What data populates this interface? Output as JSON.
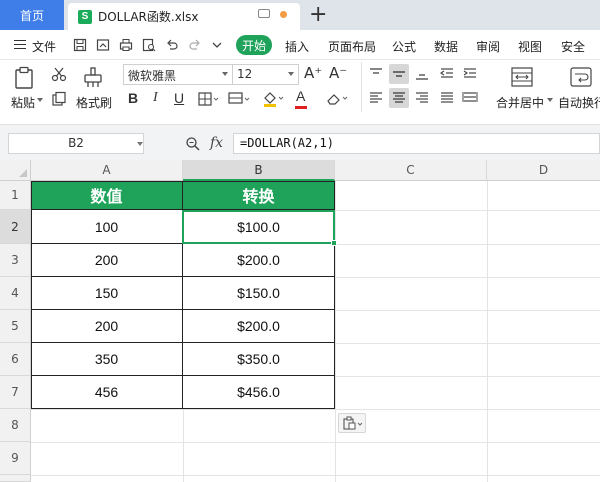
{
  "tabs": {
    "home_label": "首页",
    "file_name": "DOLLAR函数.xlsx",
    "file_icon_letter": "S"
  },
  "menu": {
    "file_label": "文件",
    "start_label": "开始",
    "items": [
      "插入",
      "页面布局",
      "公式",
      "数据",
      "审阅",
      "视图",
      "安全"
    ]
  },
  "ribbon": {
    "paste_label": "粘贴",
    "format_painter_label": "格式刷",
    "font_name": "微软雅黑",
    "font_size": "12",
    "merge_label": "合并居中",
    "wrap_label": "自动换行",
    "bold": "B",
    "italic": "I",
    "underline": "U",
    "font_color_glyph": "A",
    "grow_font": "A⁺",
    "shrink_font": "A⁻"
  },
  "formula_bar": {
    "name_box": "B2",
    "fx_label": "fx",
    "formula": "=DOLLAR(A2,1)"
  },
  "sheet": {
    "columns": [
      "A",
      "B",
      "C",
      "D"
    ],
    "rows": [
      "1",
      "2",
      "3",
      "4",
      "5",
      "6",
      "7",
      "8",
      "9"
    ],
    "header_a": "数值",
    "header_b": "转换",
    "data": [
      {
        "a": "100",
        "b": "$100.0"
      },
      {
        "a": "200",
        "b": "$200.0"
      },
      {
        "a": "150",
        "b": "$150.0"
      },
      {
        "a": "200",
        "b": "$200.0"
      },
      {
        "a": "350",
        "b": "$350.0"
      },
      {
        "a": "456",
        "b": "$456.0"
      }
    ],
    "selected_cell": "B2"
  },
  "colors": {
    "accent_green": "#1fa35a",
    "tab_blue": "#3f7ee8"
  }
}
